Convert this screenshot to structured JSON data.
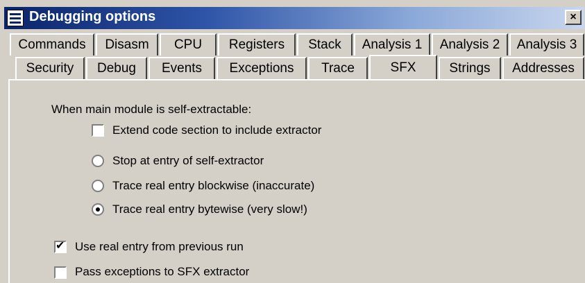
{
  "window": {
    "title": "Debugging options",
    "close_label": "×"
  },
  "tabs": {
    "row1": [
      "Commands",
      "Disasm",
      "CPU",
      "Registers",
      "Stack",
      "Analysis 1",
      "Analysis 2",
      "Analysis 3"
    ],
    "row2": [
      "Security",
      "Debug",
      "Events",
      "Exceptions",
      "Trace",
      "SFX",
      "Strings",
      "Addresses"
    ],
    "selected": "SFX"
  },
  "sfx": {
    "heading": "When main module is self-extractable:",
    "extend_code": {
      "label": "Extend code section to include extractor",
      "checked": false
    },
    "radios": [
      {
        "label": "Stop at entry of self-extractor",
        "checked": false
      },
      {
        "label": "Trace real entry blockwise (inaccurate)",
        "checked": false
      },
      {
        "label": "Trace real entry bytewise (very slow!)",
        "checked": true
      }
    ],
    "use_real_entry": {
      "label": "Use real entry from previous run",
      "checked": true
    },
    "pass_exceptions": {
      "label": "Pass exceptions to SFX extractor",
      "checked": false
    }
  }
}
